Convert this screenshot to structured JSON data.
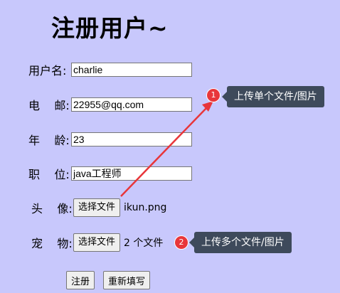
{
  "page": {
    "title": "注册用户~"
  },
  "form": {
    "username": {
      "label": "用户名:",
      "value": "charlie"
    },
    "email": {
      "label": "电    邮:",
      "value": "22955@qq.com"
    },
    "age": {
      "label": "年    龄:",
      "value": "23"
    },
    "job": {
      "label": "职    位:",
      "value": "java工程师"
    },
    "avatar": {
      "label": "头    像:",
      "button": "选择文件",
      "status": "ikun.png"
    },
    "pet": {
      "label": "宠    物:",
      "button": "选择文件",
      "status": "2 个文件"
    },
    "submit_label": "注册",
    "reset_label": "重新填写"
  },
  "annotations": {
    "badge1": "1",
    "tooltip1": "上传单个文件/图片",
    "badge2": "2",
    "tooltip2": "上传多个文件/图片",
    "accent_color": "#e8363a",
    "tooltip_color": "#3e4a5b",
    "background_color": "#c8c8fc"
  }
}
